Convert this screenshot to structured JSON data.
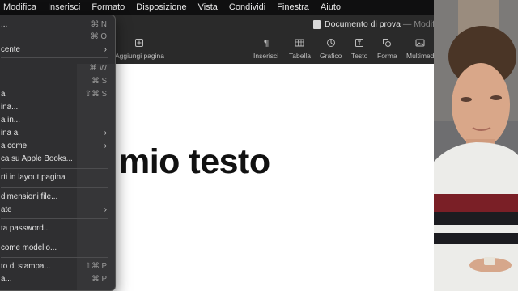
{
  "menubar": {
    "items": [
      "Modifica",
      "Inserisci",
      "Formato",
      "Disposizione",
      "Vista",
      "Condividi",
      "Finestra",
      "Aiuto"
    ]
  },
  "window": {
    "title": "Documento di prova",
    "separator": "—",
    "subtitle": "Modif"
  },
  "toolbar": {
    "add_page": "Aggiungi pagina",
    "insert": "Inserisci",
    "table": "Tabella",
    "chart": "Grafico",
    "text": "Testo",
    "shape": "Forma",
    "media": "Multimed"
  },
  "document": {
    "text": "mio testo"
  },
  "file_menu": {
    "items": [
      {
        "label": "...",
        "shortcut": "⌘ N"
      },
      {
        "label": "",
        "shortcut": "⌘ O"
      },
      {
        "label": "cente",
        "shortcut": ""
      },
      {
        "label": "",
        "shortcut": "⌘ W"
      },
      {
        "label": "",
        "shortcut": "⌘ S"
      },
      {
        "label": "a",
        "shortcut": "⇧⌘ S"
      },
      {
        "label": "ina...",
        "shortcut": ""
      },
      {
        "label": "a in...",
        "shortcut": ""
      },
      {
        "label": "ina a",
        "shortcut": ""
      },
      {
        "label": "a come",
        "shortcut": ""
      },
      {
        "label": "ca su Apple Books...",
        "shortcut": ""
      },
      {
        "label": "rti in layout pagina",
        "shortcut": ""
      },
      {
        "label": "dimensioni file...",
        "shortcut": ""
      },
      {
        "label": "ate",
        "shortcut": ""
      },
      {
        "label": "ta password...",
        "shortcut": ""
      },
      {
        "label": "come modello...",
        "shortcut": ""
      },
      {
        "label": "to di stampa...",
        "shortcut": "⇧⌘ P"
      },
      {
        "label": "a...",
        "shortcut": "⌘ P"
      }
    ]
  },
  "colors": {
    "menubar_bg": "#0f0f10",
    "menu_bg": "#303032",
    "page_bg": "#ffffff",
    "text": "#111111"
  }
}
